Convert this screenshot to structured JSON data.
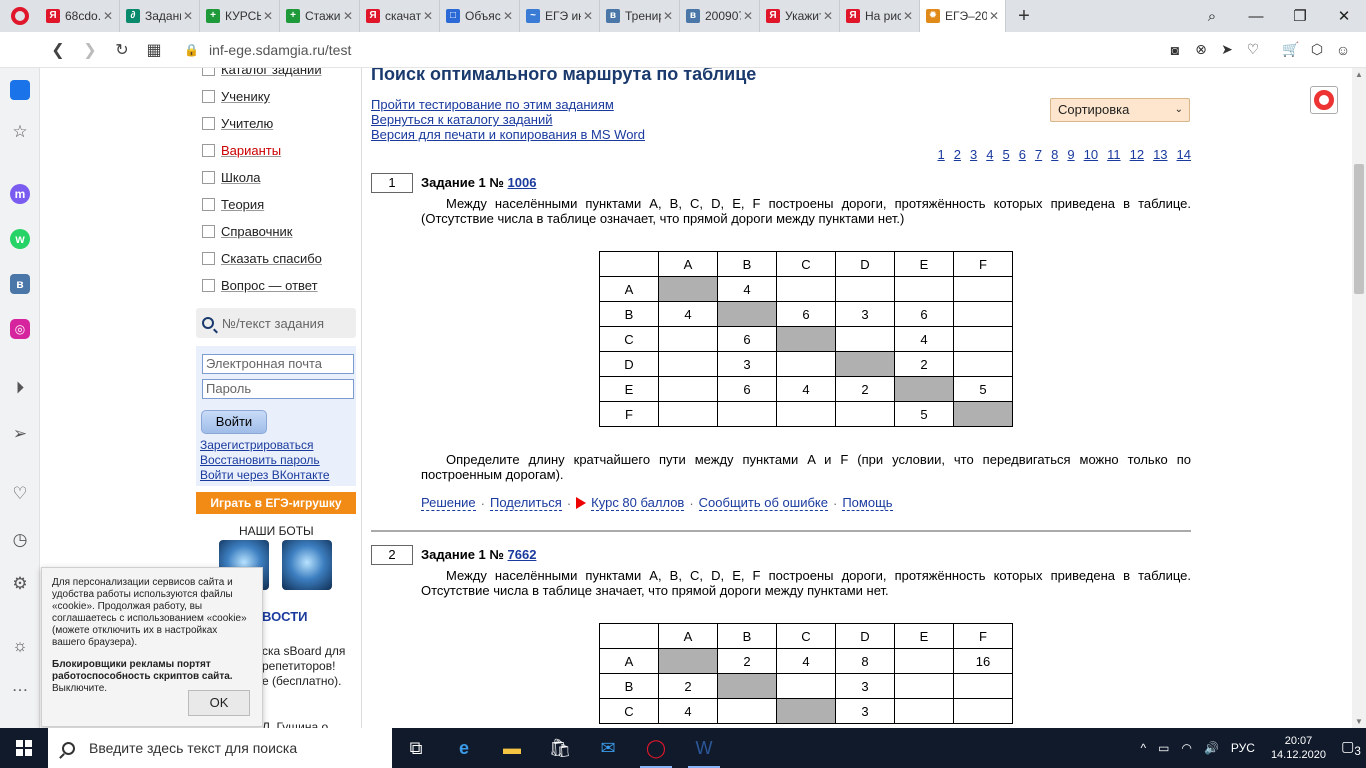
{
  "tabs": [
    {
      "label": "68cdo.r",
      "color": "#e0162b",
      "glyph": "Я"
    },
    {
      "label": "Задани",
      "color": "#0a8a6c",
      "glyph": "∂"
    },
    {
      "label": "КУРСЫ",
      "color": "#1e9a3b",
      "glyph": "+"
    },
    {
      "label": "Стажир",
      "color": "#1e9a3b",
      "glyph": "+"
    },
    {
      "label": "скачат",
      "color": "#e0162b",
      "glyph": "Я"
    },
    {
      "label": "Объясн",
      "color": "#2b6ad6",
      "glyph": "□"
    },
    {
      "label": "ЕГЭ ин",
      "color": "#3a7bd5",
      "glyph": "~"
    },
    {
      "label": "Тренир",
      "color": "#4a76a8",
      "glyph": "в"
    },
    {
      "label": "200907",
      "color": "#4a76a8",
      "glyph": "в"
    },
    {
      "label": "Укажит",
      "color": "#e0162b",
      "glyph": "Я"
    },
    {
      "label": "На рис",
      "color": "#e0162b",
      "glyph": "Я"
    },
    {
      "label": "ЕГЭ–20",
      "color": "#e08a1a",
      "glyph": "✹"
    }
  ],
  "address": {
    "url": "inf-ege.sdamgia.ru/test"
  },
  "sitenav": {
    "items": [
      {
        "label": "Каталог заданий",
        "red": false
      },
      {
        "label": "Ученику",
        "red": false
      },
      {
        "label": "Учителю",
        "red": false
      },
      {
        "label": "Варианты",
        "red": true
      },
      {
        "label": "Школа",
        "red": false
      },
      {
        "label": "Теория",
        "red": false
      },
      {
        "label": "Справочник",
        "red": false
      },
      {
        "label": "Сказать спасибо",
        "red": false
      },
      {
        "label": "Вопрос — ответ",
        "red": false
      }
    ],
    "search_placeholder": "№/текст задания",
    "email_placeholder": "Электронная почта",
    "password_placeholder": "Пароль",
    "login_button": "Войти",
    "register_link": "Зарегистрироваться",
    "restore_link": "Восстановить пароль",
    "vk_link": "Войти через ВКонтакте",
    "game_button": "Играть в ЕГЭ-игрушку",
    "bots_heading": "НАШИ БОТЫ",
    "news_heading": "ВОСТИ",
    "news_lines": [
      "ска sBoard для",
      "репетиторов!",
      "е (бесплатно).",
      "Л. Гущина о"
    ]
  },
  "cookie": {
    "text": "Для персонализации сервисов сайта и удобства работы используются файлы «cookie». Продолжая работу, вы соглашаетесь с использованием «cookie» (можете отключить их в настройках вашего браузера).",
    "bold_text": "Блокировщики рекламы портят работоспособность скриптов сайта.",
    "bold_tail": " Выключите.",
    "ok_button": "OK"
  },
  "main": {
    "title": "Поиск оптимального маршрута по таблице",
    "links": [
      "Пройти тестирование по этим заданиям",
      "Вернуться к каталогу заданий",
      "Версия для печати и копирования в MS Word"
    ],
    "sort_label": "Сортировка",
    "pages": [
      "1",
      "2",
      "3",
      "4",
      "5",
      "6",
      "7",
      "8",
      "9",
      "10",
      "11",
      "12",
      "13",
      "14"
    ]
  },
  "tasks": [
    {
      "num": "1",
      "head": "Задание 1 № ",
      "id": "1006",
      "text": "Между населёнными пунктами A, B, C, D, E, F построены дороги, протяжённость которых приведена в таблице. (Отсутствие числа в таблице означает, что прямой дороги между пунктами нет.)",
      "table": [
        [
          "",
          "A",
          "B",
          "C",
          "D",
          "E",
          "F"
        ],
        [
          "A",
          "",
          "4",
          "",
          "",
          "",
          ""
        ],
        [
          "B",
          "4",
          "",
          "6",
          "3",
          "6",
          ""
        ],
        [
          "C",
          "",
          "6",
          "",
          "",
          "4",
          ""
        ],
        [
          "D",
          "",
          "3",
          "",
          "",
          "2",
          ""
        ],
        [
          "E",
          "",
          "6",
          "4",
          "2",
          "",
          "5"
        ],
        [
          "F",
          "",
          "",
          "",
          "",
          "5",
          ""
        ]
      ],
      "question": "Определите длину кратчайшего пути между пунктами A и F (при условии, что передвигаться можно только по построенным дорогам).",
      "actions": [
        "Решение",
        "Поделиться",
        "Курс 80 баллов",
        "Сообщить об ошибке",
        "Помощь"
      ]
    },
    {
      "num": "2",
      "head": "Задание 1 № ",
      "id": "7662",
      "text": "Между населёнными пунктами A, B, C, D, E, F построены дороги, протяжённость которых приведена в таблице. Отсутствие числа в таблице значает, что прямой дороги между пунктами нет.",
      "table": [
        [
          "",
          "A",
          "B",
          "C",
          "D",
          "E",
          "F"
        ],
        [
          "A",
          "",
          "2",
          "4",
          "8",
          "",
          "16"
        ],
        [
          "B",
          "2",
          "",
          "",
          "3",
          "",
          ""
        ],
        [
          "C",
          "4",
          "",
          "",
          "3",
          "",
          ""
        ]
      ]
    }
  ],
  "taskbar": {
    "search_placeholder": "Введите здесь текст для поиска",
    "lang": "РУС",
    "time": "20:07",
    "date": "14.12.2020",
    "notif_count": "3"
  }
}
